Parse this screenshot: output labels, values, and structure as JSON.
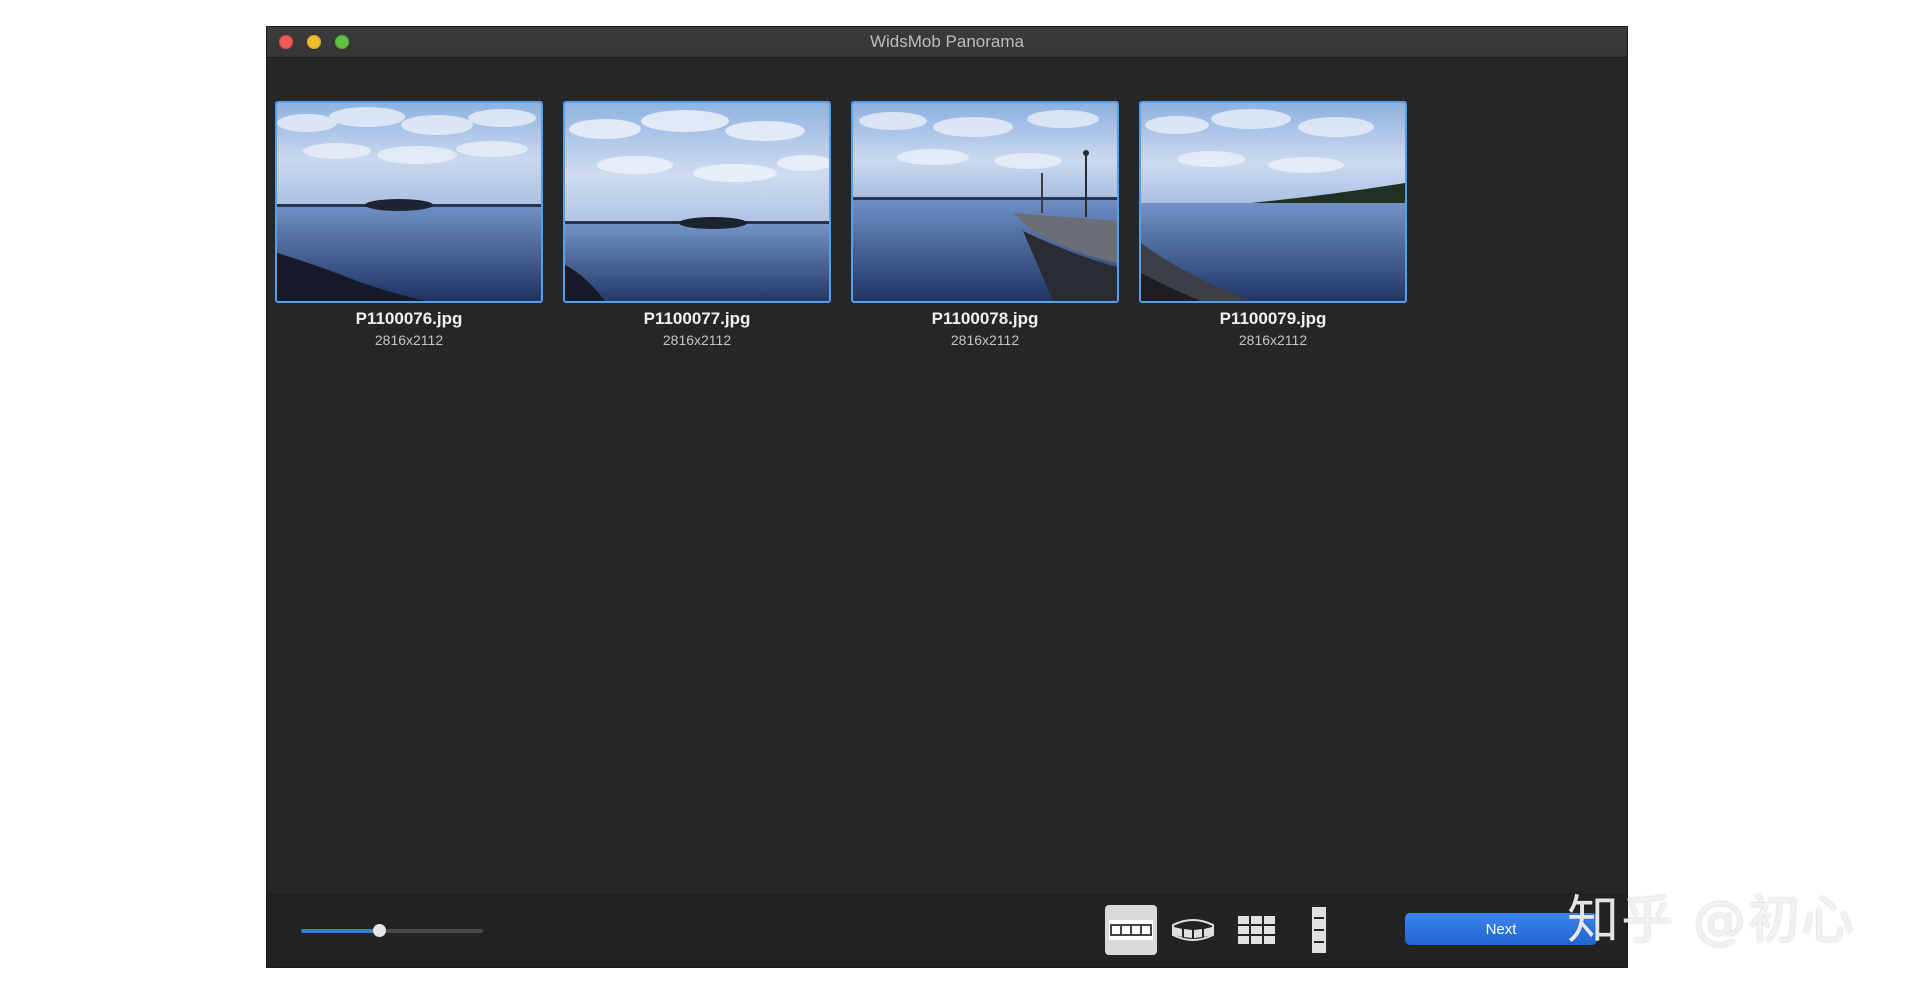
{
  "window": {
    "title": "WidsMob Panorama"
  },
  "images": [
    {
      "filename": "P1100076.jpg",
      "dimensions": "2816x2112"
    },
    {
      "filename": "P1100077.jpg",
      "dimensions": "2816x2112"
    },
    {
      "filename": "P1100078.jpg",
      "dimensions": "2816x2112"
    },
    {
      "filename": "P1100079.jpg",
      "dimensions": "2816x2112"
    }
  ],
  "toolbar": {
    "zoom_level": 0.43,
    "modes": [
      {
        "icon": "horizontal-panorama-icon",
        "active": true
      },
      {
        "icon": "360-panorama-icon",
        "active": false
      },
      {
        "icon": "tile-grid-icon",
        "active": false
      },
      {
        "icon": "vertical-panorama-icon",
        "active": false
      }
    ],
    "next_label": "Next"
  },
  "watermark": "知乎 @初心",
  "colors": {
    "window_bg": "#262626",
    "accent": "#3a7bd5",
    "thumb_border": "#5a9ee8"
  }
}
